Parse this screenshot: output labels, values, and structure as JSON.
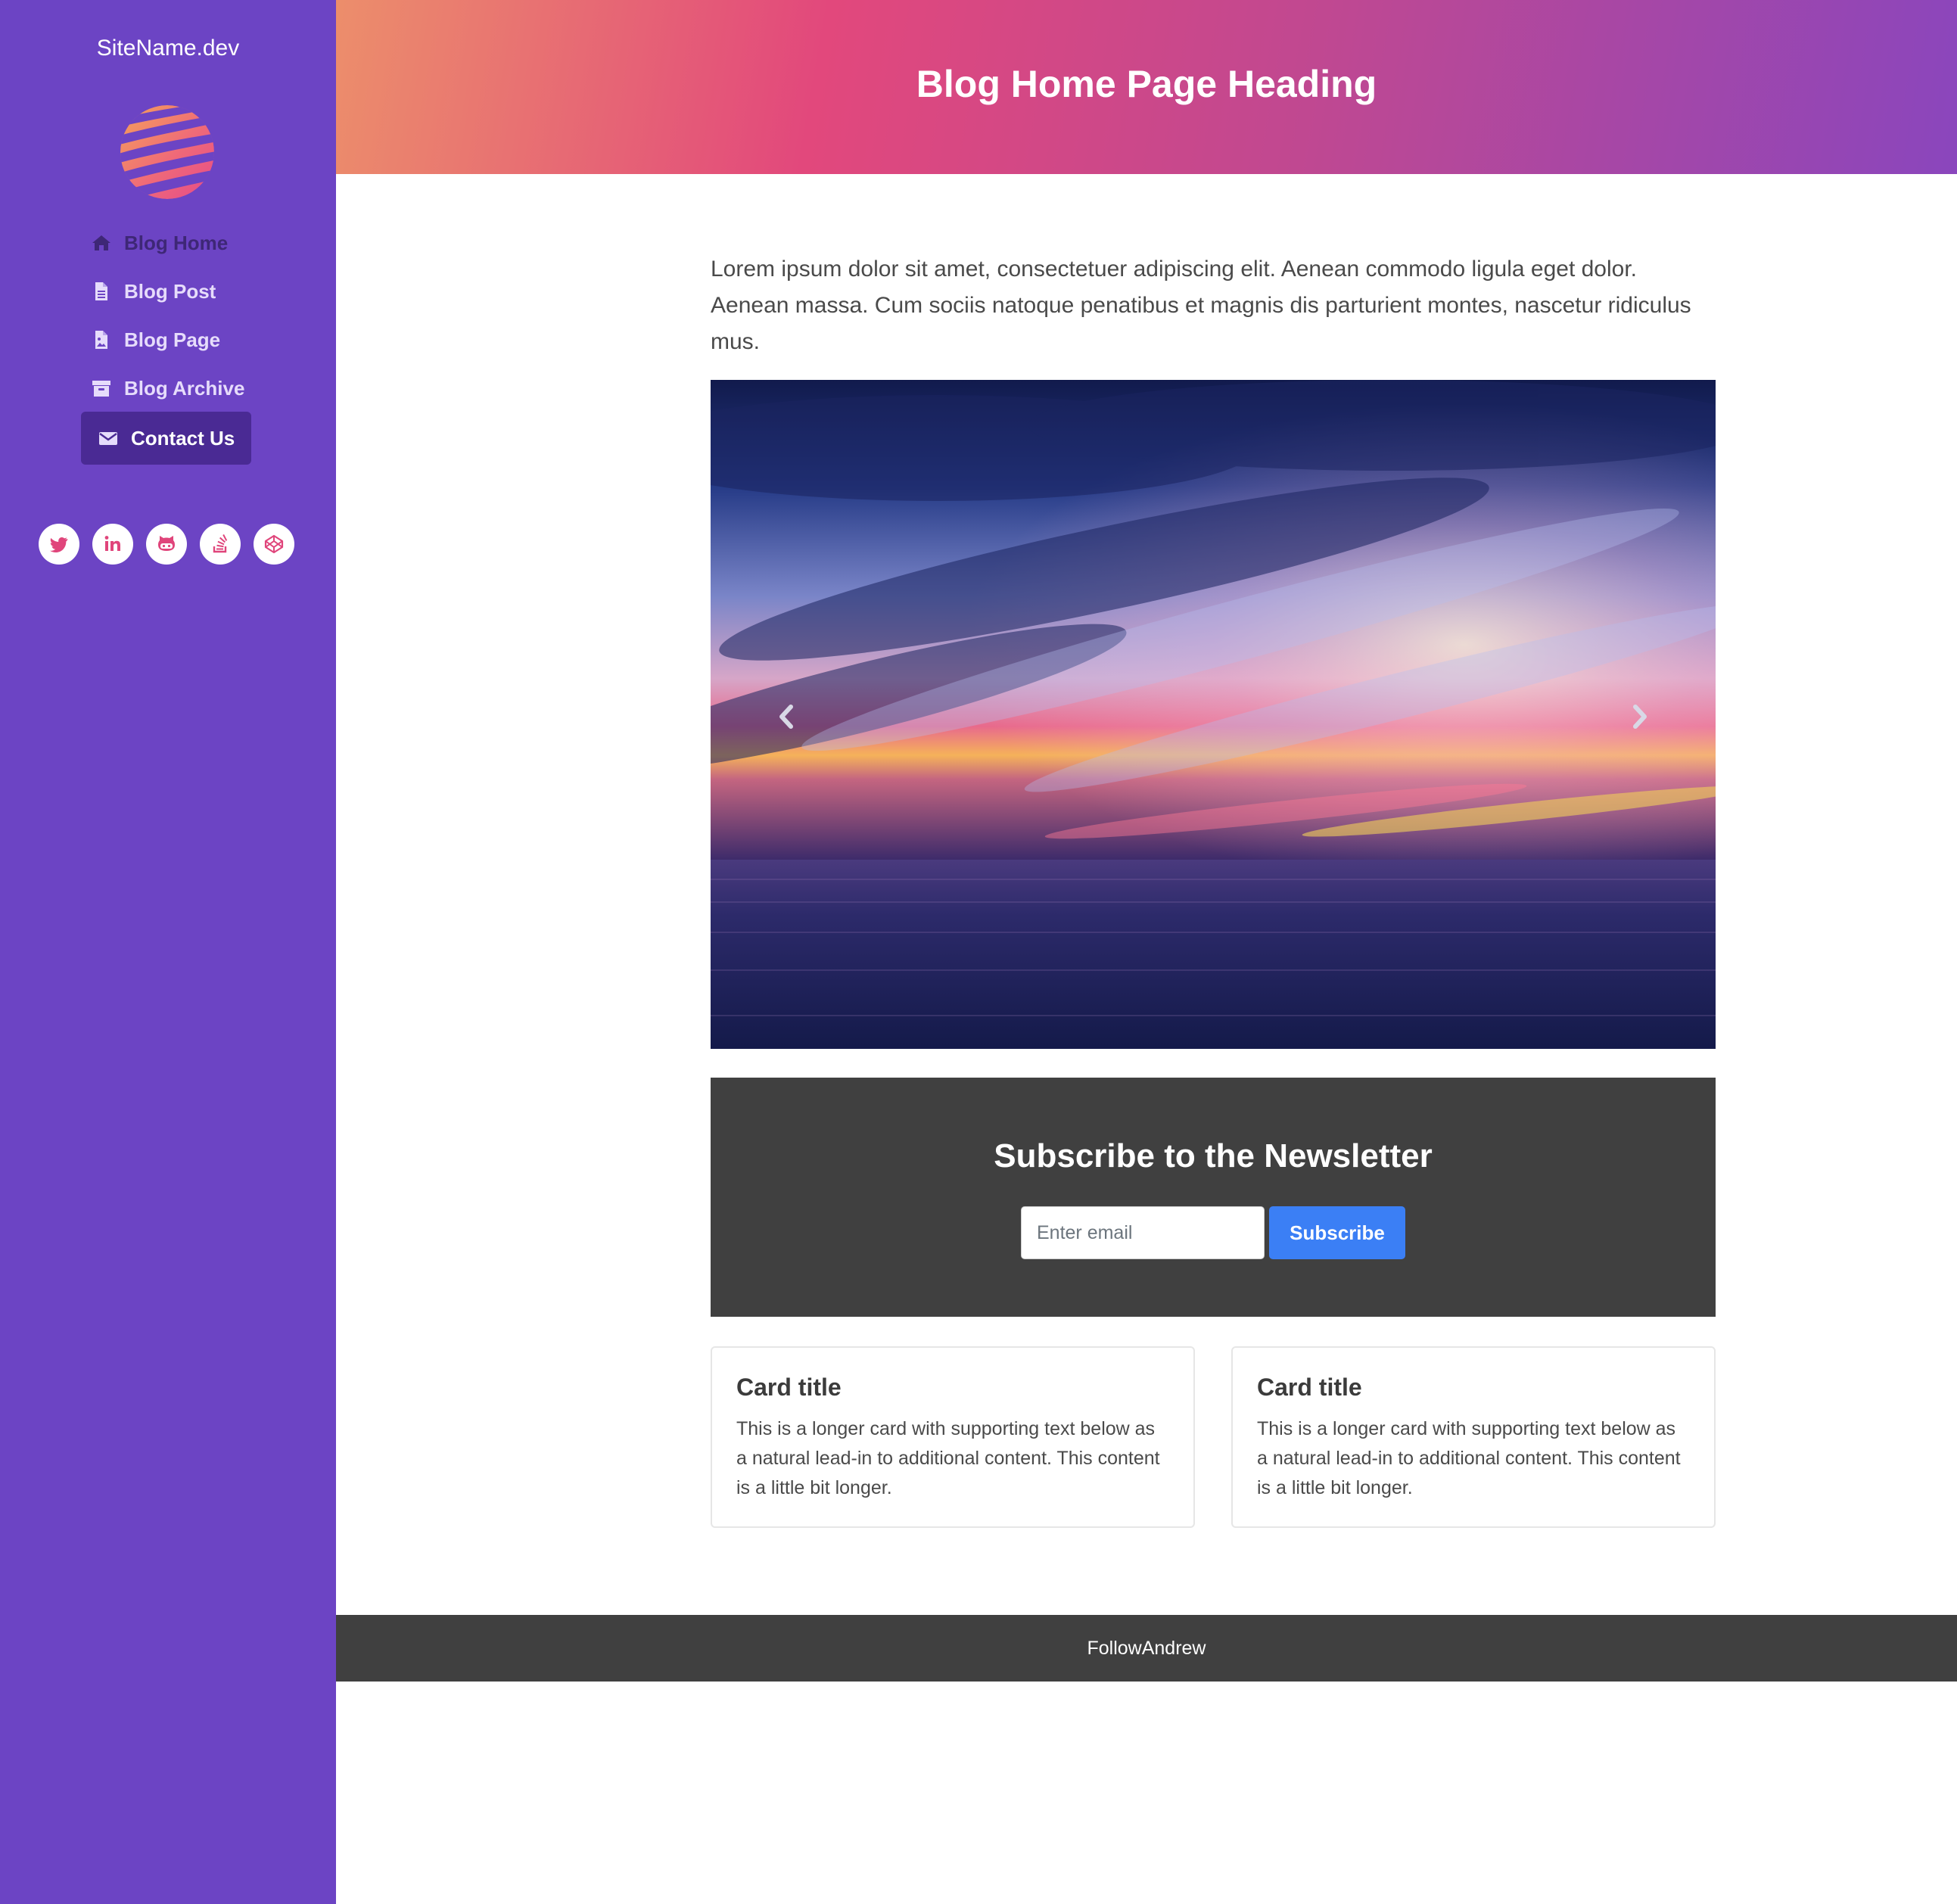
{
  "colors": {
    "sidebar_bg": "#6c44c4",
    "active_nav_bg": "#4a2a94",
    "header_gradient": [
      "#ec8e6b",
      "#e2487c",
      "#c04891",
      "#8a46bd"
    ],
    "newsletter_bg": "#404040",
    "subscribe_button": "#3b7ff5",
    "social_icon": "#e0457b"
  },
  "sidebar": {
    "site_name": "SiteName.dev",
    "logo_icon": "striped-globe-icon",
    "nav": [
      {
        "label": "Blog Home",
        "icon": "home-icon"
      },
      {
        "label": "Blog Post",
        "icon": "file-icon"
      },
      {
        "label": "Blog Page",
        "icon": "file-image-icon"
      },
      {
        "label": "Blog Archive",
        "icon": "archive-icon"
      },
      {
        "label": "Contact Us",
        "icon": "envelope-icon",
        "active": true
      }
    ],
    "socials": [
      "twitter-icon",
      "linkedin-icon",
      "github-icon",
      "stackoverflow-icon",
      "codepen-icon"
    ]
  },
  "header": {
    "title": "Blog Home Page Heading"
  },
  "main": {
    "intro": "Lorem ipsum dolor sit amet, consectetuer adipiscing elit. Aenean commodo ligula eget dolor. Aenean massa. Cum sociis natoque penatibus et magnis dis parturient montes, nascetur ridiculus mus.",
    "carousel": {
      "prev_icon": "chevron-left-icon",
      "next_icon": "chevron-right-icon"
    },
    "newsletter": {
      "title": "Subscribe to the Newsletter",
      "email_placeholder": "Enter email",
      "email_value": "",
      "button_label": "Subscribe"
    },
    "cards": [
      {
        "title": "Card title",
        "text": "This is a longer card with supporting text below as a natural lead-in to additional content. This content is a little bit longer."
      },
      {
        "title": "Card title",
        "text": "This is a longer card with supporting text below as a natural lead-in to additional content. This content is a little bit longer."
      }
    ]
  },
  "footer": {
    "text": "FollowAndrew"
  }
}
